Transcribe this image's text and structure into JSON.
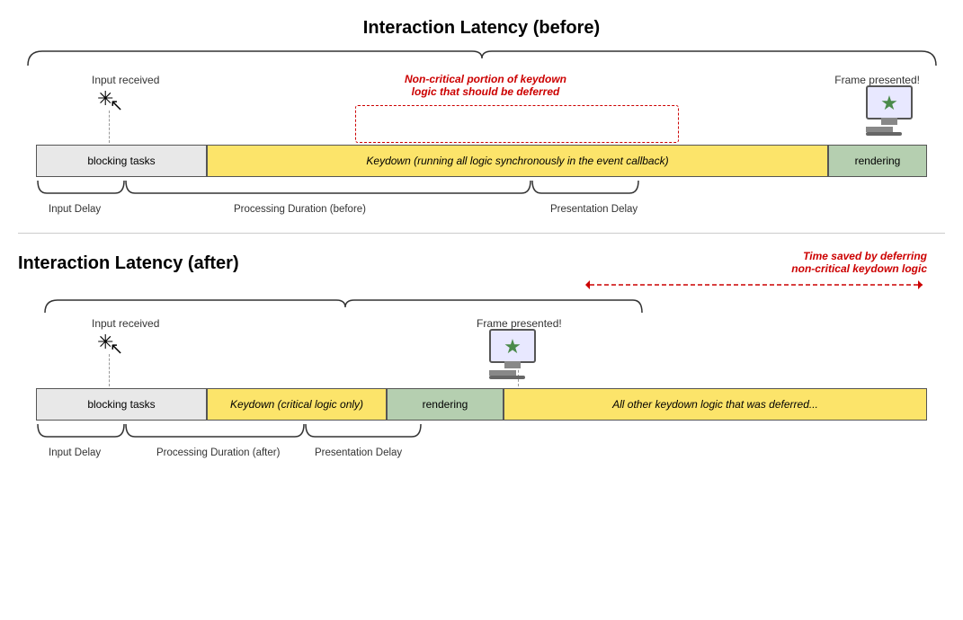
{
  "top_section": {
    "title": "Interaction Latency (before)",
    "input_label": "Input received",
    "frame_label": "Frame presented!",
    "blocking_label": "blocking tasks",
    "keydown_label": "Keydown (running all logic synchronously in the event callback)",
    "rendering_label": "rendering",
    "input_delay_label": "Input Delay",
    "processing_duration_label": "Processing Duration (before)",
    "presentation_delay_label": "Presentation Delay",
    "non_critical_label_line1": "Non-critical portion of keydown",
    "non_critical_label_line2": "logic that should be deferred"
  },
  "bottom_section": {
    "title": "Interaction Latency (after)",
    "input_label": "Input received",
    "frame_label": "Frame presented!",
    "blocking_label": "blocking tasks",
    "keydown_label": "Keydown (critical logic only)",
    "rendering_label": "rendering",
    "deferred_label": "All other keydown logic that was deferred...",
    "input_delay_label": "Input Delay",
    "processing_duration_label": "Processing Duration (after)",
    "presentation_delay_label": "Presentation Delay",
    "time_saved_line1": "Time saved by deferring",
    "time_saved_line2": "non-critical keydown logic"
  },
  "colors": {
    "blocking": "#e8e8e8",
    "keydown": "#fce46a",
    "rendering": "#b5cfb0",
    "red": "#cc0000",
    "text": "#333333"
  }
}
